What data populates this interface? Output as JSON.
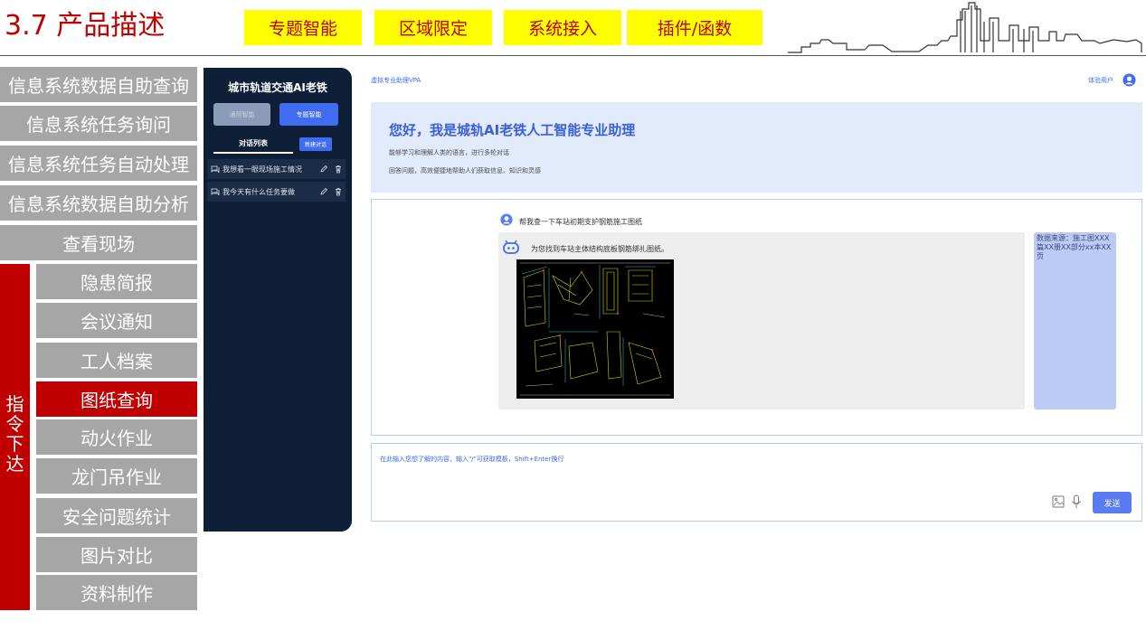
{
  "slide": {
    "title": "3.7 产品描述",
    "tags": [
      "专题智能",
      "区域限定",
      "系统接入",
      "插件/函数"
    ]
  },
  "menu": {
    "items": [
      "信息系统数据自助查询",
      "信息系统任务询问",
      "信息系统任务自动处理",
      "信息系统数据自助分析",
      "查看现场"
    ],
    "command_label": "指\n令\n下\n达",
    "sub_items": [
      "隐患简报",
      "会议通知",
      "工人档案",
      "图纸查询",
      "动火作业",
      "龙门吊作业",
      "安全问题统计",
      "图片对比",
      "资料制作"
    ],
    "active_sub_item": "图纸查询",
    "active_color": "#c00000",
    "inactive_color": "#a6a6a6"
  },
  "app": {
    "name": "虚拟专业助理VPA",
    "user_name": "体验用户",
    "sidebar": {
      "title": "城市轨道交通AI老铁",
      "general_button": "通用智能",
      "topic_button": "专题智能",
      "conversation_list_title": "对话列表",
      "new_conversation_button": "新建对话",
      "conversations": [
        "我想看一眼现场施工情况",
        "我今天有什么任务要做"
      ]
    },
    "welcome": {
      "title": "您好，我是城轨AI老铁人工智能专业助理",
      "line1": "能够学习和理解人类的语言，进行多轮对话",
      "line2": "回答问题，高效便捷地帮助人们获取信息、知识和灵感"
    },
    "chat": {
      "user_question": "帮我查一下车站初期支护钢筋施工图纸",
      "assistant_answer": "为您找到车站主体结构底板钢筋绑扎图纸。",
      "source": "数据来源：施工图XXX篇XX册XX部分xx本XX页"
    },
    "input": {
      "placeholder": "在此输入您想了解的内容，输入\"/\"可获取模板，Shift+Enter换行",
      "send_button": "发送"
    },
    "accent_color": "#3f6cf0"
  }
}
